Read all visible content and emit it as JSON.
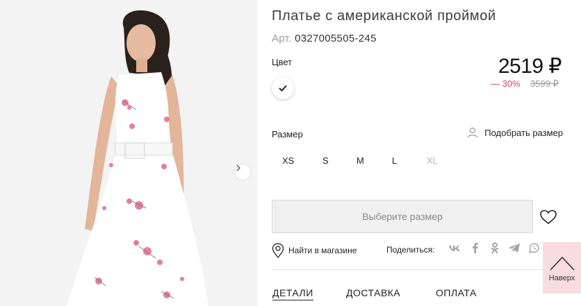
{
  "product": {
    "title": "Платье с американской проймой",
    "sku_label": "Арт.",
    "sku_value": "0327005505-245"
  },
  "color": {
    "label": "Цвет",
    "selected_swatch": "#ffffff"
  },
  "price": {
    "current": "2519 ₽",
    "discount": "— 30%",
    "old": "3599 ₽",
    "discount_color": "#d0476b"
  },
  "size": {
    "label": "Размер",
    "guide_label": "Подобрать размер",
    "options": [
      {
        "label": "XS",
        "available": true
      },
      {
        "label": "S",
        "available": true
      },
      {
        "label": "M",
        "available": true
      },
      {
        "label": "L",
        "available": true
      },
      {
        "label": "XL",
        "available": false
      }
    ]
  },
  "actions": {
    "select_size_button": "Выберите размер",
    "find_in_store": "Найти в магазине",
    "share_label": "Поделиться:",
    "share_icons": [
      "vk-icon",
      "facebook-icon",
      "odnoklassniki-icon",
      "telegram-icon",
      "whatsapp-icon",
      "viber-icon"
    ]
  },
  "tabs": [
    {
      "label": "ДЕТАЛИ",
      "active": true
    },
    {
      "label": "ДОСТАВКА",
      "active": false
    },
    {
      "label": "ОПЛАТА",
      "active": false
    }
  ],
  "scroll_top": {
    "label": "Наверх",
    "bg_color": "#f9dce0"
  }
}
